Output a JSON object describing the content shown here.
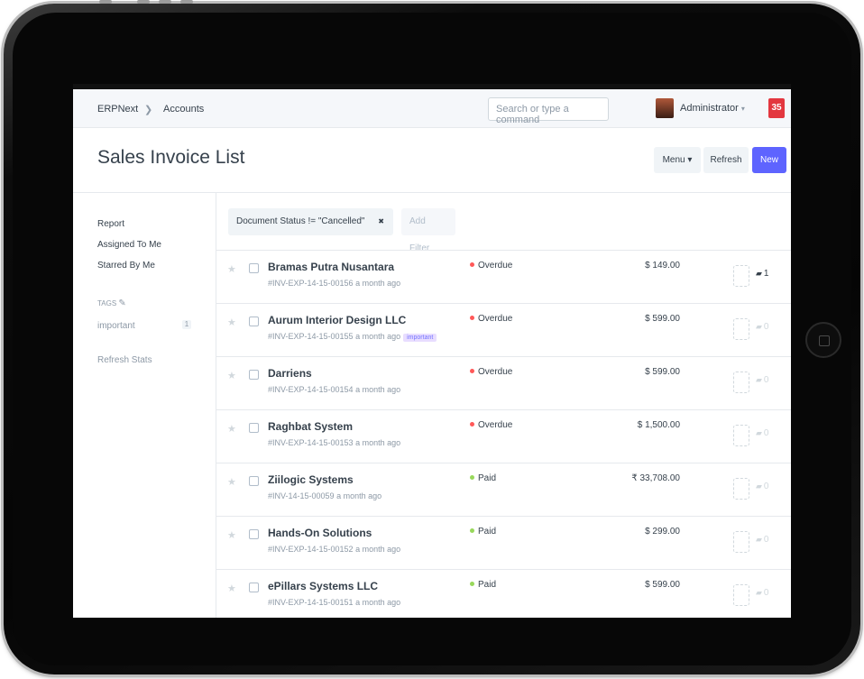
{
  "navbar": {
    "brand": "ERPNext",
    "separator": "❯",
    "module": "Accounts",
    "search_placeholder": "Search or type a command",
    "user": "Administrator",
    "user_caret": "▾",
    "notifications": "35"
  },
  "page": {
    "title": "Sales Invoice List",
    "menu_label": "Menu ▾",
    "refresh_label": "Refresh",
    "new_label": "New"
  },
  "sidebar": {
    "report": "Report",
    "assigned": "Assigned To Me",
    "starred": "Starred By Me",
    "tags_heading": "TAGS",
    "tag_name": "important",
    "tag_count": "1",
    "refresh_stats": "Refresh Stats"
  },
  "filters": {
    "active": "Document Status != \"Cancelled\"",
    "remove_glyph": "✖",
    "add": "Add Filter"
  },
  "icons": {
    "star": "★",
    "pencil": "✎",
    "comment": "▰"
  },
  "colors": {
    "overdue": "#ff5858",
    "paid": "#98d85b",
    "primary": "#5e64ff",
    "notification": "#e3373f"
  },
  "invoices": [
    {
      "customer": "Bramas Putra Nusantara",
      "id": "#INV-EXP-14-15-00156",
      "time": "a month ago",
      "tag": "",
      "status": "Overdue",
      "status_color": "#ff5858",
      "amount": "$ 149.00",
      "comments": "1"
    },
    {
      "customer": "Aurum Interior Design LLC",
      "id": "#INV-EXP-14-15-00155",
      "time": "a month ago",
      "tag": "important",
      "status": "Overdue",
      "status_color": "#ff5858",
      "amount": "$ 599.00",
      "comments": "0"
    },
    {
      "customer": "Darriens",
      "id": "#INV-EXP-14-15-00154",
      "time": "a month ago",
      "tag": "",
      "status": "Overdue",
      "status_color": "#ff5858",
      "amount": "$ 599.00",
      "comments": "0"
    },
    {
      "customer": "Raghbat System",
      "id": "#INV-EXP-14-15-00153",
      "time": "a month ago",
      "tag": "",
      "status": "Overdue",
      "status_color": "#ff5858",
      "amount": "$ 1,500.00",
      "comments": "0"
    },
    {
      "customer": "Ziilogic Systems",
      "id": "#INV-14-15-00059",
      "time": "a month ago",
      "tag": "",
      "status": "Paid",
      "status_color": "#98d85b",
      "amount": "₹ 33,708.00",
      "comments": "0"
    },
    {
      "customer": "Hands-On Solutions",
      "id": "#INV-EXP-14-15-00152",
      "time": "a month ago",
      "tag": "",
      "status": "Paid",
      "status_color": "#98d85b",
      "amount": "$ 299.00",
      "comments": "0"
    },
    {
      "customer": "ePillars Systems LLC",
      "id": "#INV-EXP-14-15-00151",
      "time": "a month ago",
      "tag": "",
      "status": "Paid",
      "status_color": "#98d85b",
      "amount": "$ 599.00",
      "comments": "0"
    }
  ]
}
